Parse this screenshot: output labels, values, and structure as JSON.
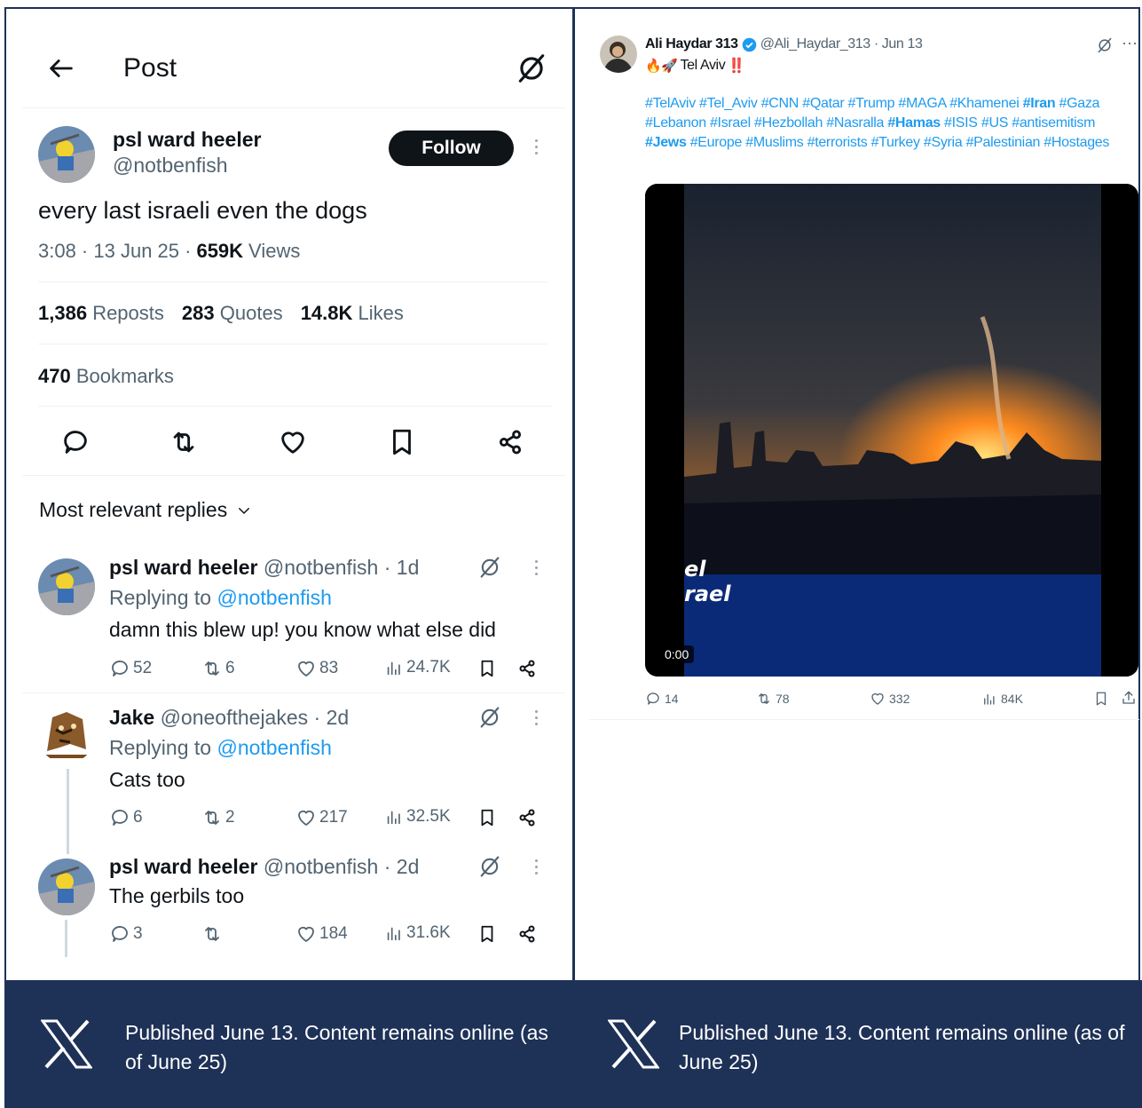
{
  "left_post": {
    "header_title": "Post",
    "author_name": "psl ward heeler",
    "author_handle": "@notbenfish",
    "follow_label": "Follow",
    "text": "every last israeli even the dogs",
    "time_date": "3:08 · 13 Jun 25 ·",
    "views_count": "659K",
    "views_label": "Views",
    "reposts_count": "1,386",
    "reposts_label": "Reposts",
    "quotes_count": "283",
    "quotes_label": "Quotes",
    "likes_count": "14.8K",
    "likes_label": "Likes",
    "bookmarks_count": "470",
    "bookmarks_label": "Bookmarks",
    "sort_label": "Most relevant replies",
    "replies": [
      {
        "name": "psl ward heeler",
        "meta": "@notbenfish · 1d",
        "replying_prefix": "Replying to",
        "replying_to": "@notbenfish",
        "text": "damn this blew up! you know what else did",
        "comments": "52",
        "reposts": "6",
        "likes": "83",
        "views": "24.7K"
      },
      {
        "name": "Jake",
        "meta": "@oneofthejakes · 2d",
        "replying_prefix": "Replying to",
        "replying_to": "@notbenfish",
        "text": "Cats too",
        "comments": "6",
        "reposts": "2",
        "likes": "217",
        "views": "32.5K"
      },
      {
        "name": "psl ward heeler",
        "meta": "@notbenfish · 2d",
        "text": "The gerbils too",
        "comments": "3",
        "reposts": "",
        "likes": "184",
        "views": "31.6K"
      }
    ]
  },
  "right_post": {
    "author_name": "Ali Haydar 313",
    "handle_date": "@Ali_Haydar_313 · Jun 13",
    "subtitle_text": "Tel Aviv",
    "subtitle_emoji_left": "🔥🚀",
    "subtitle_emoji_right": "‼️",
    "hashtags": [
      {
        "t": "#TelAviv",
        "b": false
      },
      {
        "t": "#Tel_Aviv",
        "b": false
      },
      {
        "t": "#CNN",
        "b": false
      },
      {
        "t": "#Qatar",
        "b": false
      },
      {
        "t": "#Trump",
        "b": false
      },
      {
        "t": "#MAGA",
        "b": false
      },
      {
        "t": "#Khamenei",
        "b": false
      },
      {
        "t": "#Iran",
        "b": true
      },
      {
        "t": "#Gaza",
        "b": false
      },
      {
        "t": "#Lebanon",
        "b": false
      },
      {
        "t": "#Israel",
        "b": false
      },
      {
        "t": "#Hezbollah",
        "b": false
      },
      {
        "t": "#Nasralla",
        "b": false
      },
      {
        "t": "#Hamas",
        "b": true
      },
      {
        "t": "#ISIS",
        "b": false
      },
      {
        "t": "#US",
        "b": false
      },
      {
        "t": "#antisemitism",
        "b": false
      },
      {
        "t": "#Jews",
        "b": true
      },
      {
        "t": "#Europe",
        "b": false
      },
      {
        "t": "#Muslims",
        "b": false
      },
      {
        "t": "#terrorists",
        "b": false
      },
      {
        "t": "#Turkey",
        "b": false
      },
      {
        "t": "#Syria",
        "b": false
      },
      {
        "t": "#Palestinian",
        "b": false
      },
      {
        "t": "#Hostages",
        "b": false
      }
    ],
    "video_text_1": "el",
    "video_text_2": "rael",
    "video_time": "0:00",
    "comments": "14",
    "reposts": "78",
    "likes": "332",
    "views": "84K"
  },
  "captions": {
    "left": "Published June 13. Content remains online (as of June 25)",
    "right": "Published June 13. Content remains online (as of June 25)"
  },
  "colors": {
    "navy": "#1e3157",
    "link_blue": "#1d9bf0",
    "muted_gray": "#536471"
  }
}
